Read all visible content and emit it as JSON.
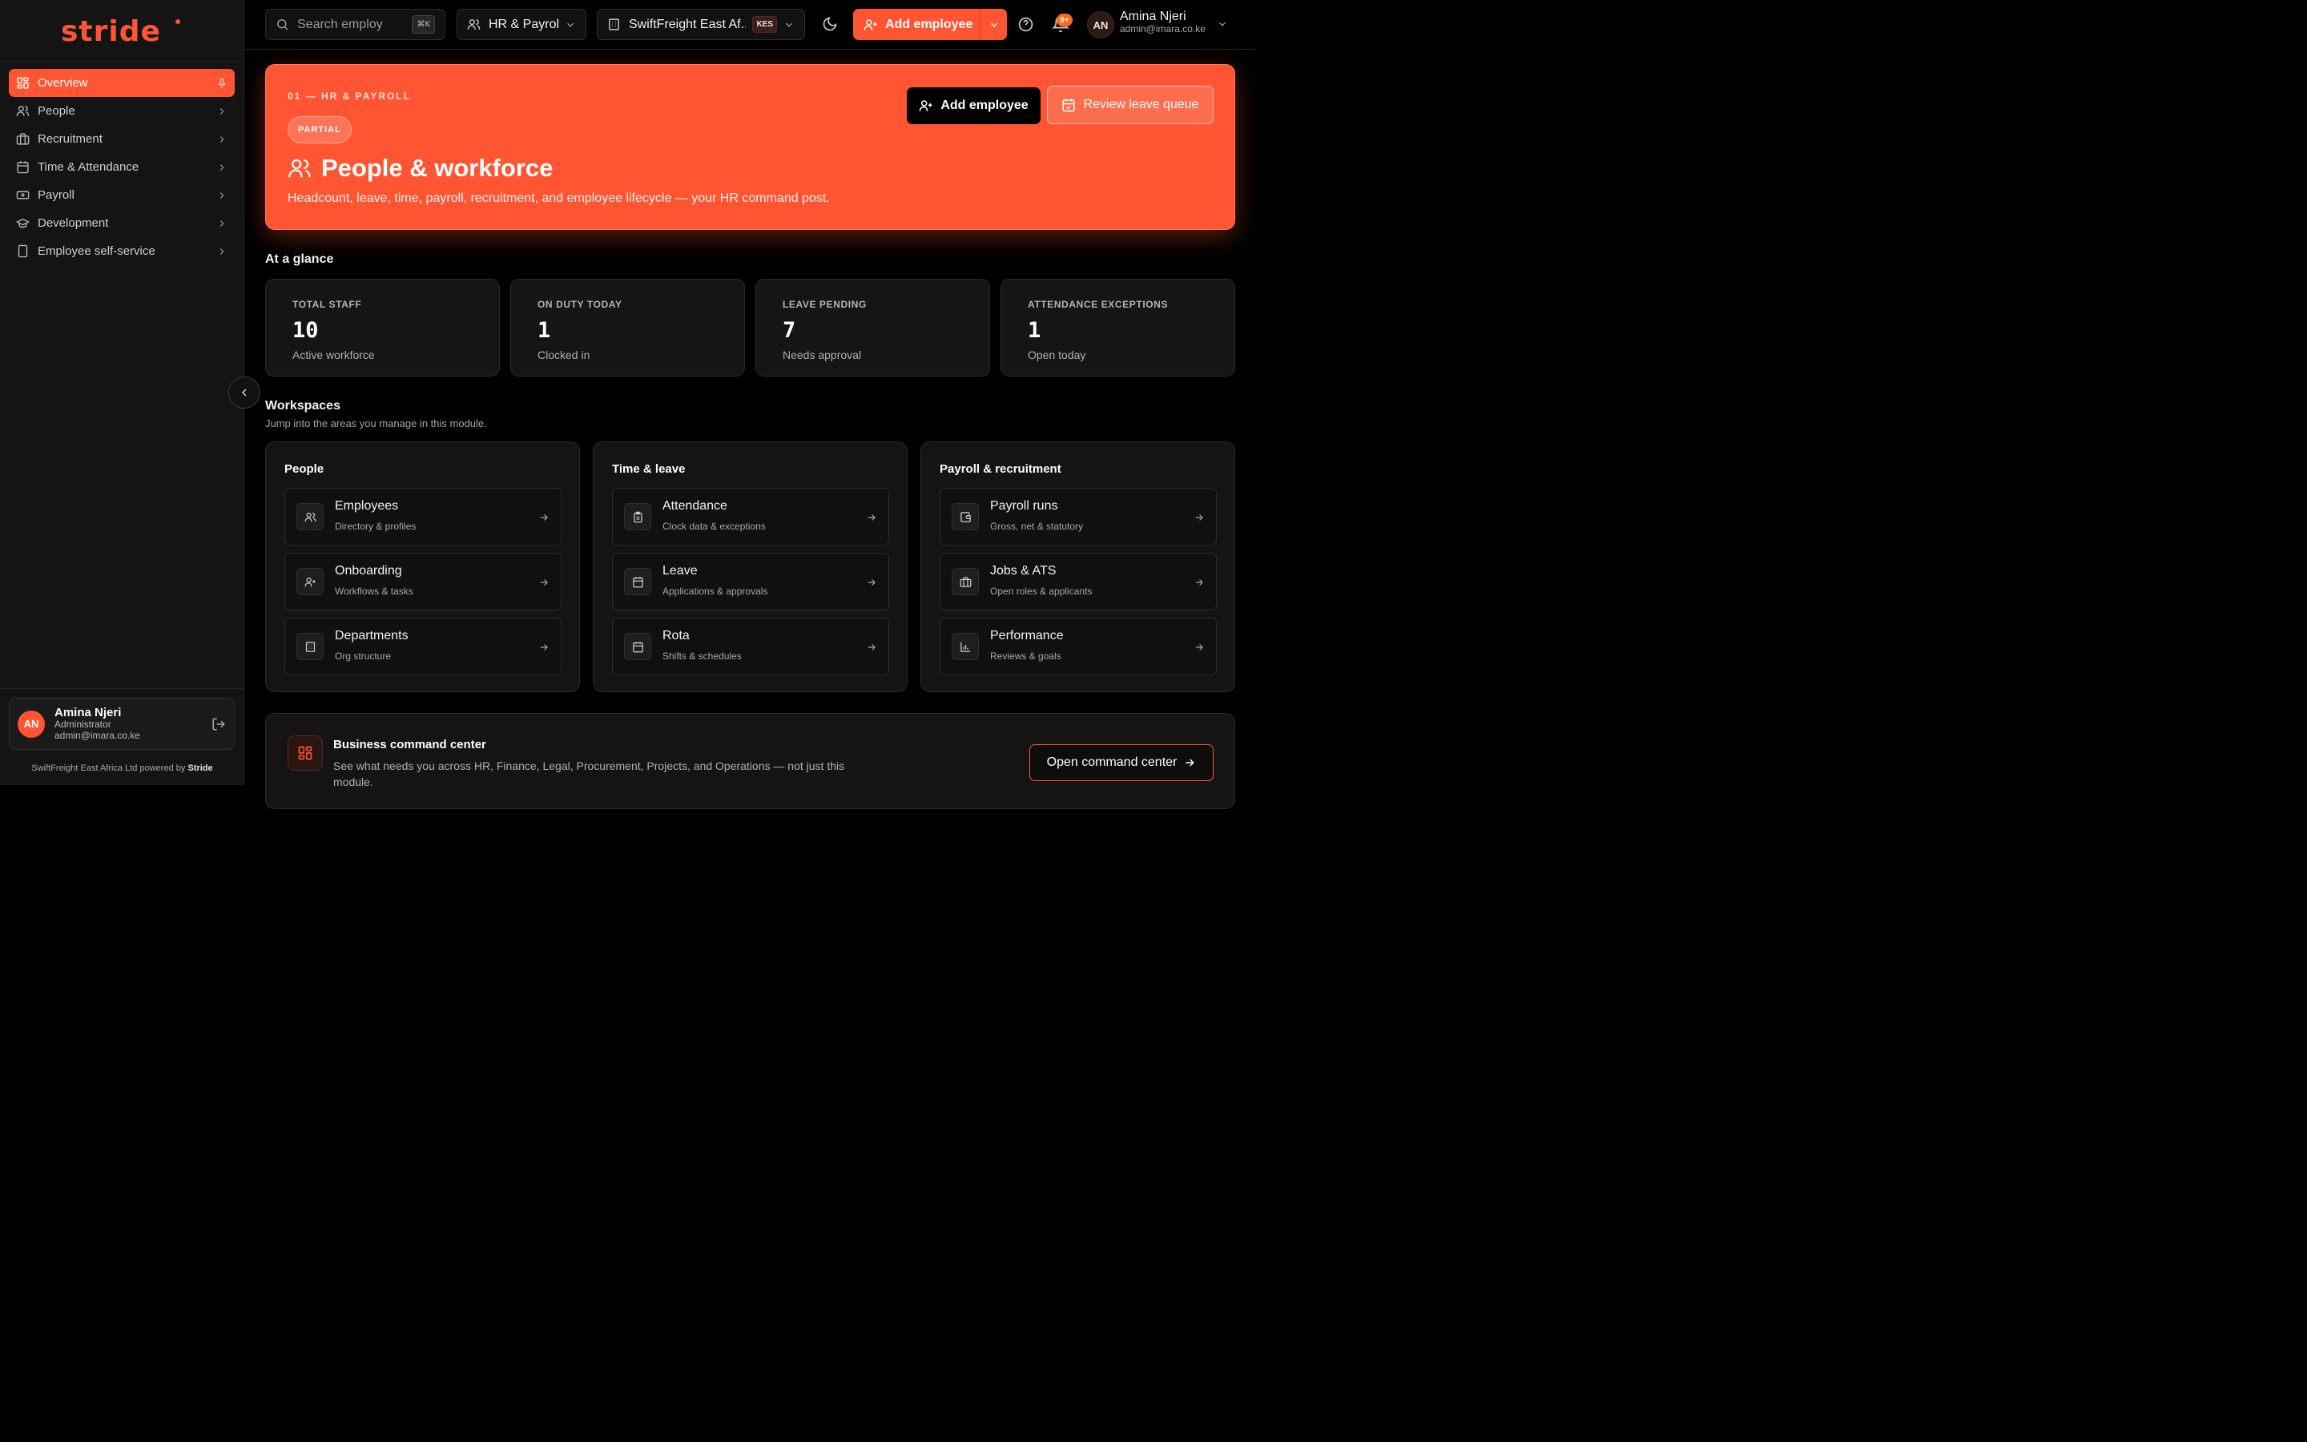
{
  "brand": {
    "logo_text": "stride",
    "accent": "#ff5533"
  },
  "sidebar": {
    "items": [
      {
        "label": "Overview",
        "icon": "dashboard-icon",
        "active": true
      },
      {
        "label": "People",
        "icon": "users-icon"
      },
      {
        "label": "Recruitment",
        "icon": "briefcase-icon"
      },
      {
        "label": "Time & Attendance",
        "icon": "calendar-icon"
      },
      {
        "label": "Payroll",
        "icon": "banknote-icon"
      },
      {
        "label": "Development",
        "icon": "graduation-cap-icon"
      },
      {
        "label": "Employee self-service",
        "icon": "phone-icon"
      }
    ],
    "user": {
      "initials": "AN",
      "name": "Amina Njeri",
      "role": "Administrator",
      "email": "admin@imara.co.ke"
    },
    "footer_company": "SwiftFreight East Africa Ltd",
    "footer_powered": "powered by",
    "footer_brand": "Stride"
  },
  "topbar": {
    "search_placeholder": "Search employ",
    "search_shortcut": "⌘K",
    "module": "HR & Payroll",
    "company": "SwiftFreight East Af...",
    "currency": "KES",
    "add_employee": "Add employee",
    "notification_count": "9+",
    "user": {
      "initials": "AN",
      "name": "Amina Njeri",
      "email": "admin@imara.co.ke"
    }
  },
  "hero": {
    "eyebrow": "01 — HR & PAYROLL",
    "badge": "PARTIAL",
    "title": "People & workforce",
    "subtitle": "Headcount, leave, time, payroll, recruitment, and employee lifecycle — your HR command post.",
    "primary_button": "Add employee",
    "secondary_button": "Review leave queue"
  },
  "glance": {
    "title": "At a glance",
    "stats": [
      {
        "label": "TOTAL STAFF",
        "value": "10",
        "note": "Active workforce"
      },
      {
        "label": "ON DUTY TODAY",
        "value": "1",
        "note": "Clocked in"
      },
      {
        "label": "LEAVE PENDING",
        "value": "7",
        "note": "Needs approval"
      },
      {
        "label": "ATTENDANCE EXCEPTIONS",
        "value": "1",
        "note": "Open today"
      }
    ]
  },
  "workspaces": {
    "title": "Workspaces",
    "subtitle": "Jump into the areas you manage in this module.",
    "groups": [
      {
        "title": "People",
        "items": [
          {
            "title": "Employees",
            "sub": "Directory & profiles",
            "icon": "users-icon"
          },
          {
            "title": "Onboarding",
            "sub": "Workflows & tasks",
            "icon": "user-plus-icon"
          },
          {
            "title": "Departments",
            "sub": "Org structure",
            "icon": "building-icon"
          }
        ]
      },
      {
        "title": "Time & leave",
        "items": [
          {
            "title": "Attendance",
            "sub": "Clock data & exceptions",
            "icon": "clipboard-icon"
          },
          {
            "title": "Leave",
            "sub": "Applications & approvals",
            "icon": "calendar-icon"
          },
          {
            "title": "Rota",
            "sub": "Shifts & schedules",
            "icon": "calendar-icon"
          }
        ]
      },
      {
        "title": "Payroll & recruitment",
        "items": [
          {
            "title": "Payroll runs",
            "sub": "Gross, net & statutory",
            "icon": "wallet-icon"
          },
          {
            "title": "Jobs & ATS",
            "sub": "Open roles & applicants",
            "icon": "briefcase-icon"
          },
          {
            "title": "Performance",
            "sub": "Reviews & goals",
            "icon": "bar-chart-icon"
          }
        ]
      }
    ]
  },
  "command_center": {
    "title": "Business command center",
    "text": "See what needs you across HR, Finance, Legal, Procurement, Projects, and Operations — not just this module.",
    "button": "Open command center"
  }
}
